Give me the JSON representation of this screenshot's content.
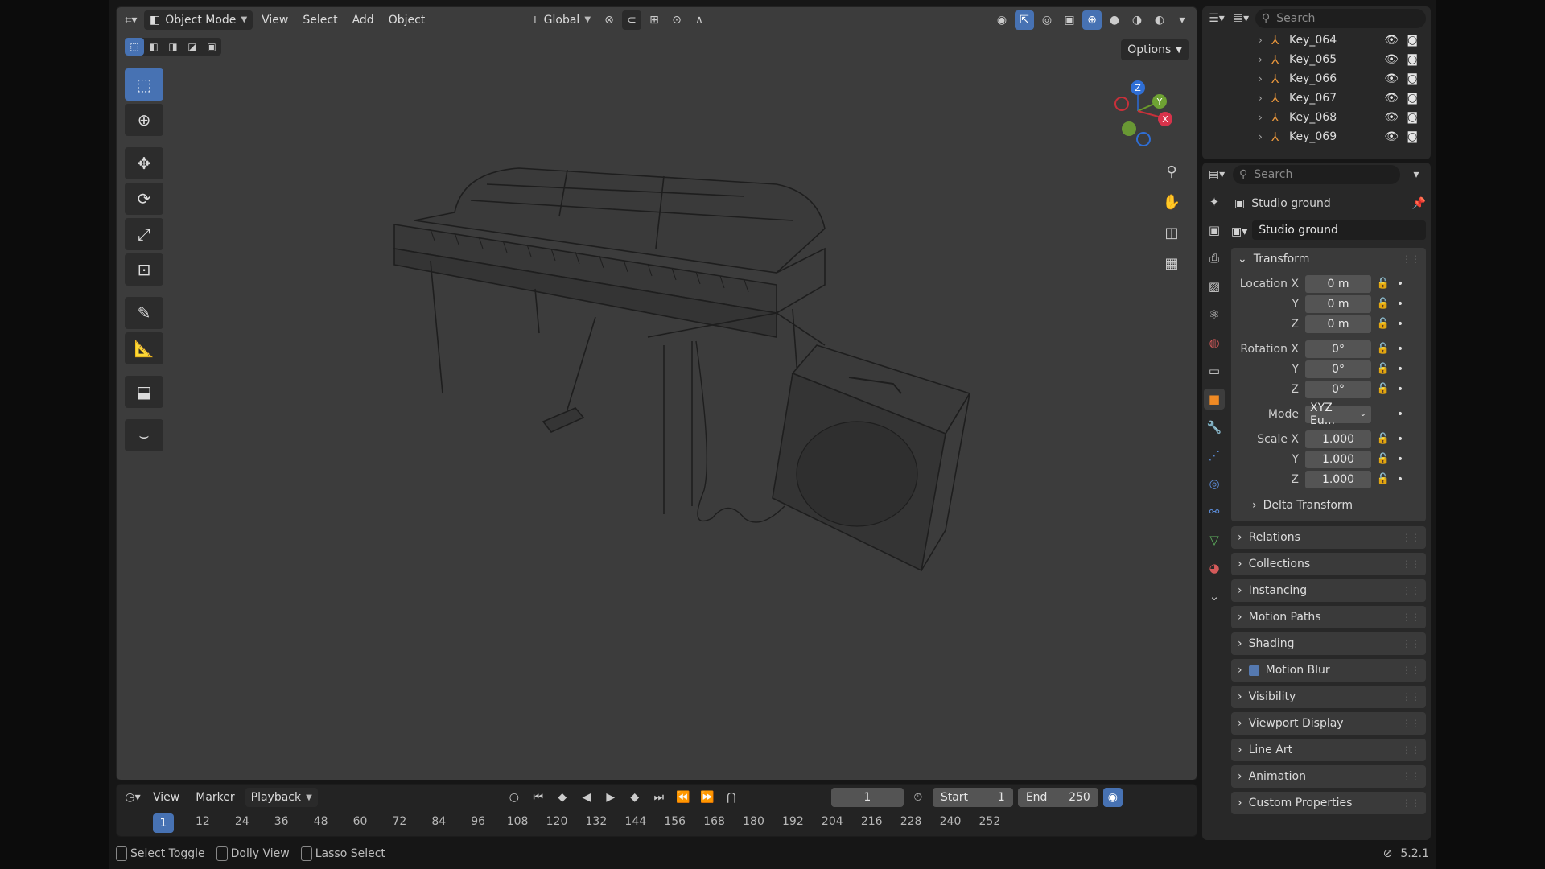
{
  "viewport": {
    "header": {
      "mode": "Object Mode",
      "menus": [
        "View",
        "Select",
        "Add",
        "Object"
      ],
      "orientation": "Global",
      "options": "Options"
    },
    "gizmo": {
      "z": "Z",
      "y": "Y",
      "x": "X"
    }
  },
  "timeline": {
    "menus": [
      "View",
      "Marker",
      "Playback"
    ],
    "current_frame": "1",
    "start_label": "Start",
    "start": "1",
    "end_label": "End",
    "end": "250",
    "ticks": [
      "1",
      "12",
      "24",
      "36",
      "48",
      "60",
      "72",
      "84",
      "96",
      "108",
      "120",
      "132",
      "144",
      "156",
      "168",
      "180",
      "192",
      "204",
      "216",
      "228",
      "240",
      "252"
    ]
  },
  "statusbar": {
    "hints": [
      "Select Toggle",
      "Dolly View",
      "Lasso Select"
    ],
    "version": "5.2.1"
  },
  "outliner": {
    "search_placeholder": "Search",
    "items": [
      "Key_064",
      "Key_065",
      "Key_066",
      "Key_067",
      "Key_068",
      "Key_069"
    ]
  },
  "properties": {
    "search_placeholder": "Search",
    "object_title": "Studio ground",
    "object_name": "Studio ground",
    "transform": {
      "title": "Transform",
      "location_label": "Location X",
      "rotation_label": "Rotation X",
      "mode_label": "Mode",
      "scale_label": "Scale X",
      "y": "Y",
      "z": "Z",
      "location": [
        "0 m",
        "0 m",
        "0 m"
      ],
      "rotation": [
        "0°",
        "0°",
        "0°"
      ],
      "mode": "XYZ Eu...",
      "scale": [
        "1.000",
        "1.000",
        "1.000"
      ],
      "delta": "Delta Transform"
    },
    "panels": [
      "Relations",
      "Collections",
      "Instancing",
      "Motion Paths",
      "Shading",
      "Motion Blur",
      "Visibility",
      "Viewport Display",
      "Line Art",
      "Animation",
      "Custom Properties"
    ]
  },
  "colors": {
    "accent": "#4772b3",
    "viewport_bg": "#3c3c3c",
    "panel_bg": "#282828"
  }
}
